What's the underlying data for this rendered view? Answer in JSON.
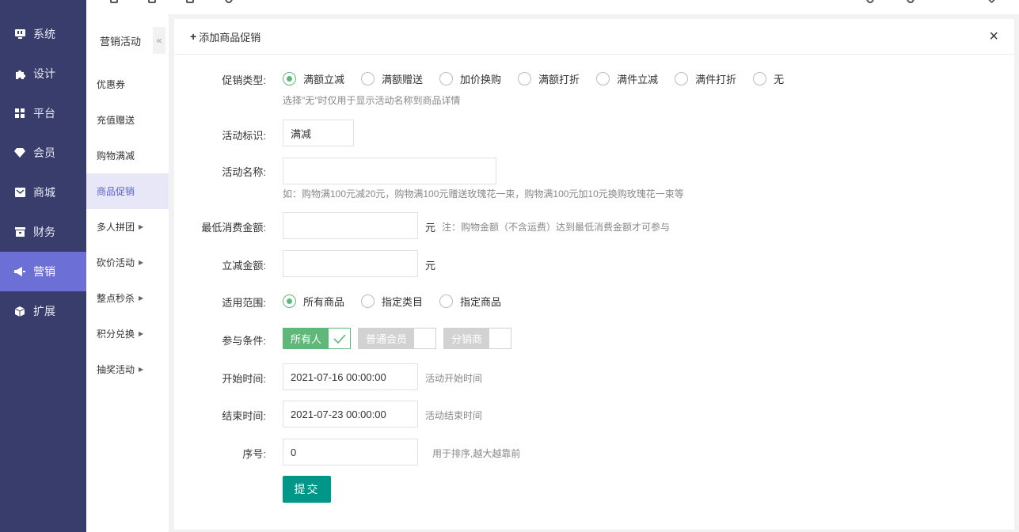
{
  "nav": {
    "items": [
      {
        "label": "系统",
        "icon": "monitor-icon"
      },
      {
        "label": "设计",
        "icon": "puzzle-icon"
      },
      {
        "label": "平台",
        "icon": "grid-icon"
      },
      {
        "label": "会员",
        "icon": "diamond-icon"
      },
      {
        "label": "商城",
        "icon": "mail-icon"
      },
      {
        "label": "财务",
        "icon": "wallet-icon"
      },
      {
        "label": "营销",
        "icon": "megaphone-icon"
      },
      {
        "label": "扩展",
        "icon": "cube-icon"
      }
    ],
    "active": "营销"
  },
  "submenu": {
    "title": "营销活动",
    "collapse": "«",
    "items": [
      {
        "label": "优惠券",
        "caret": ""
      },
      {
        "label": "充值赠送",
        "caret": ""
      },
      {
        "label": "购物满减",
        "caret": ""
      },
      {
        "label": "商品促销",
        "caret": ""
      },
      {
        "label": "多人拼团",
        "caret": "▶"
      },
      {
        "label": "砍价活动",
        "caret": "▶"
      },
      {
        "label": "整点秒杀",
        "caret": "▶"
      },
      {
        "label": "积分兑换",
        "caret": "▶"
      },
      {
        "label": "抽奖活动",
        "caret": "▶"
      }
    ],
    "active": "商品促销"
  },
  "panel": {
    "title": "添加商品促销",
    "close": "×"
  },
  "form": {
    "promo_type": {
      "label": "促销类型:",
      "options": [
        "满额立减",
        "满额赠送",
        "加价换购",
        "满额打折",
        "满件立减",
        "满件打折",
        "无"
      ],
      "selected": "满额立减",
      "hint": "选择\"无\"时仅用于显示活动名称到商品详情"
    },
    "tag": {
      "label": "活动标识:",
      "value": "满减"
    },
    "name": {
      "label": "活动名称:",
      "value": "",
      "hint": "如：购物满100元减20元，购物满100元赠送玫瑰花一束，购物满100元加10元换购玫瑰花一束等"
    },
    "min_amount": {
      "label": "最低消费金额:",
      "value": "",
      "unit": "元",
      "hint": "注：购物金额（不含运费）达到最低消费金额才可参与"
    },
    "discount": {
      "label": "立减金额:",
      "value": "",
      "unit": "元"
    },
    "scope": {
      "label": "适用范围:",
      "options": [
        "所有商品",
        "指定类目",
        "指定商品"
      ],
      "selected": "所有商品"
    },
    "condition": {
      "label": "参与条件:",
      "options": [
        {
          "label": "所有人",
          "checked": true
        },
        {
          "label": "普通会员",
          "checked": false
        },
        {
          "label": "分销商",
          "checked": false
        }
      ]
    },
    "start": {
      "label": "开始时间:",
      "value": "2021-07-16 00:00:00",
      "hint": "活动开始时间"
    },
    "end": {
      "label": "结束时间:",
      "value": "2021-07-23 00:00:00",
      "hint": "活动结束时间"
    },
    "order": {
      "label": "序号:",
      "value": "0",
      "hint": "用于排序,越大越靠前"
    },
    "submit": "提交"
  },
  "colors": {
    "nav_bg": "#393d6b",
    "nav_active": "#6c6fd6",
    "accent_green": "#5fb878",
    "submit_teal": "#009688"
  }
}
